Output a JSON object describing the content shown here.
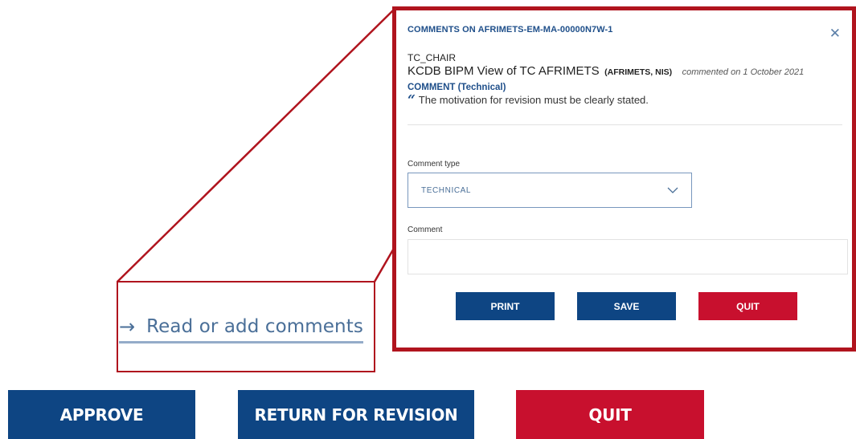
{
  "link": {
    "arrow_icon": "arrow-right-icon",
    "label": "Read or add comments"
  },
  "modal": {
    "title": "COMMENTS ON AFRIMETS-EM-MA-00000N7W-1",
    "close_icon": "close-icon",
    "comment": {
      "role": "TC_CHAIR",
      "author": "KCDB BIPM View of TC AFRIMETS",
      "org": "(AFRIMETS, NIS)",
      "date": "commented on 1 October 2021",
      "kind": "COMMENT (Technical)",
      "quote_icon": "quote-icon",
      "text": "The motivation for revision must be clearly stated."
    },
    "form": {
      "comment_type_label": "Comment type",
      "comment_type_value": "TECHNICAL",
      "comment_label": "Comment",
      "comment_value": ""
    },
    "buttons": {
      "print": "PRINT",
      "save": "SAVE",
      "quit": "QUIT"
    }
  },
  "page_buttons": {
    "approve": "APPROVE",
    "return": "RETURN FOR REVISION",
    "quit": "QUIT"
  },
  "colors": {
    "primary": "#0e4583",
    "danger": "#c8102e",
    "highlight": "#b0141e",
    "link": "#4a6f98"
  }
}
